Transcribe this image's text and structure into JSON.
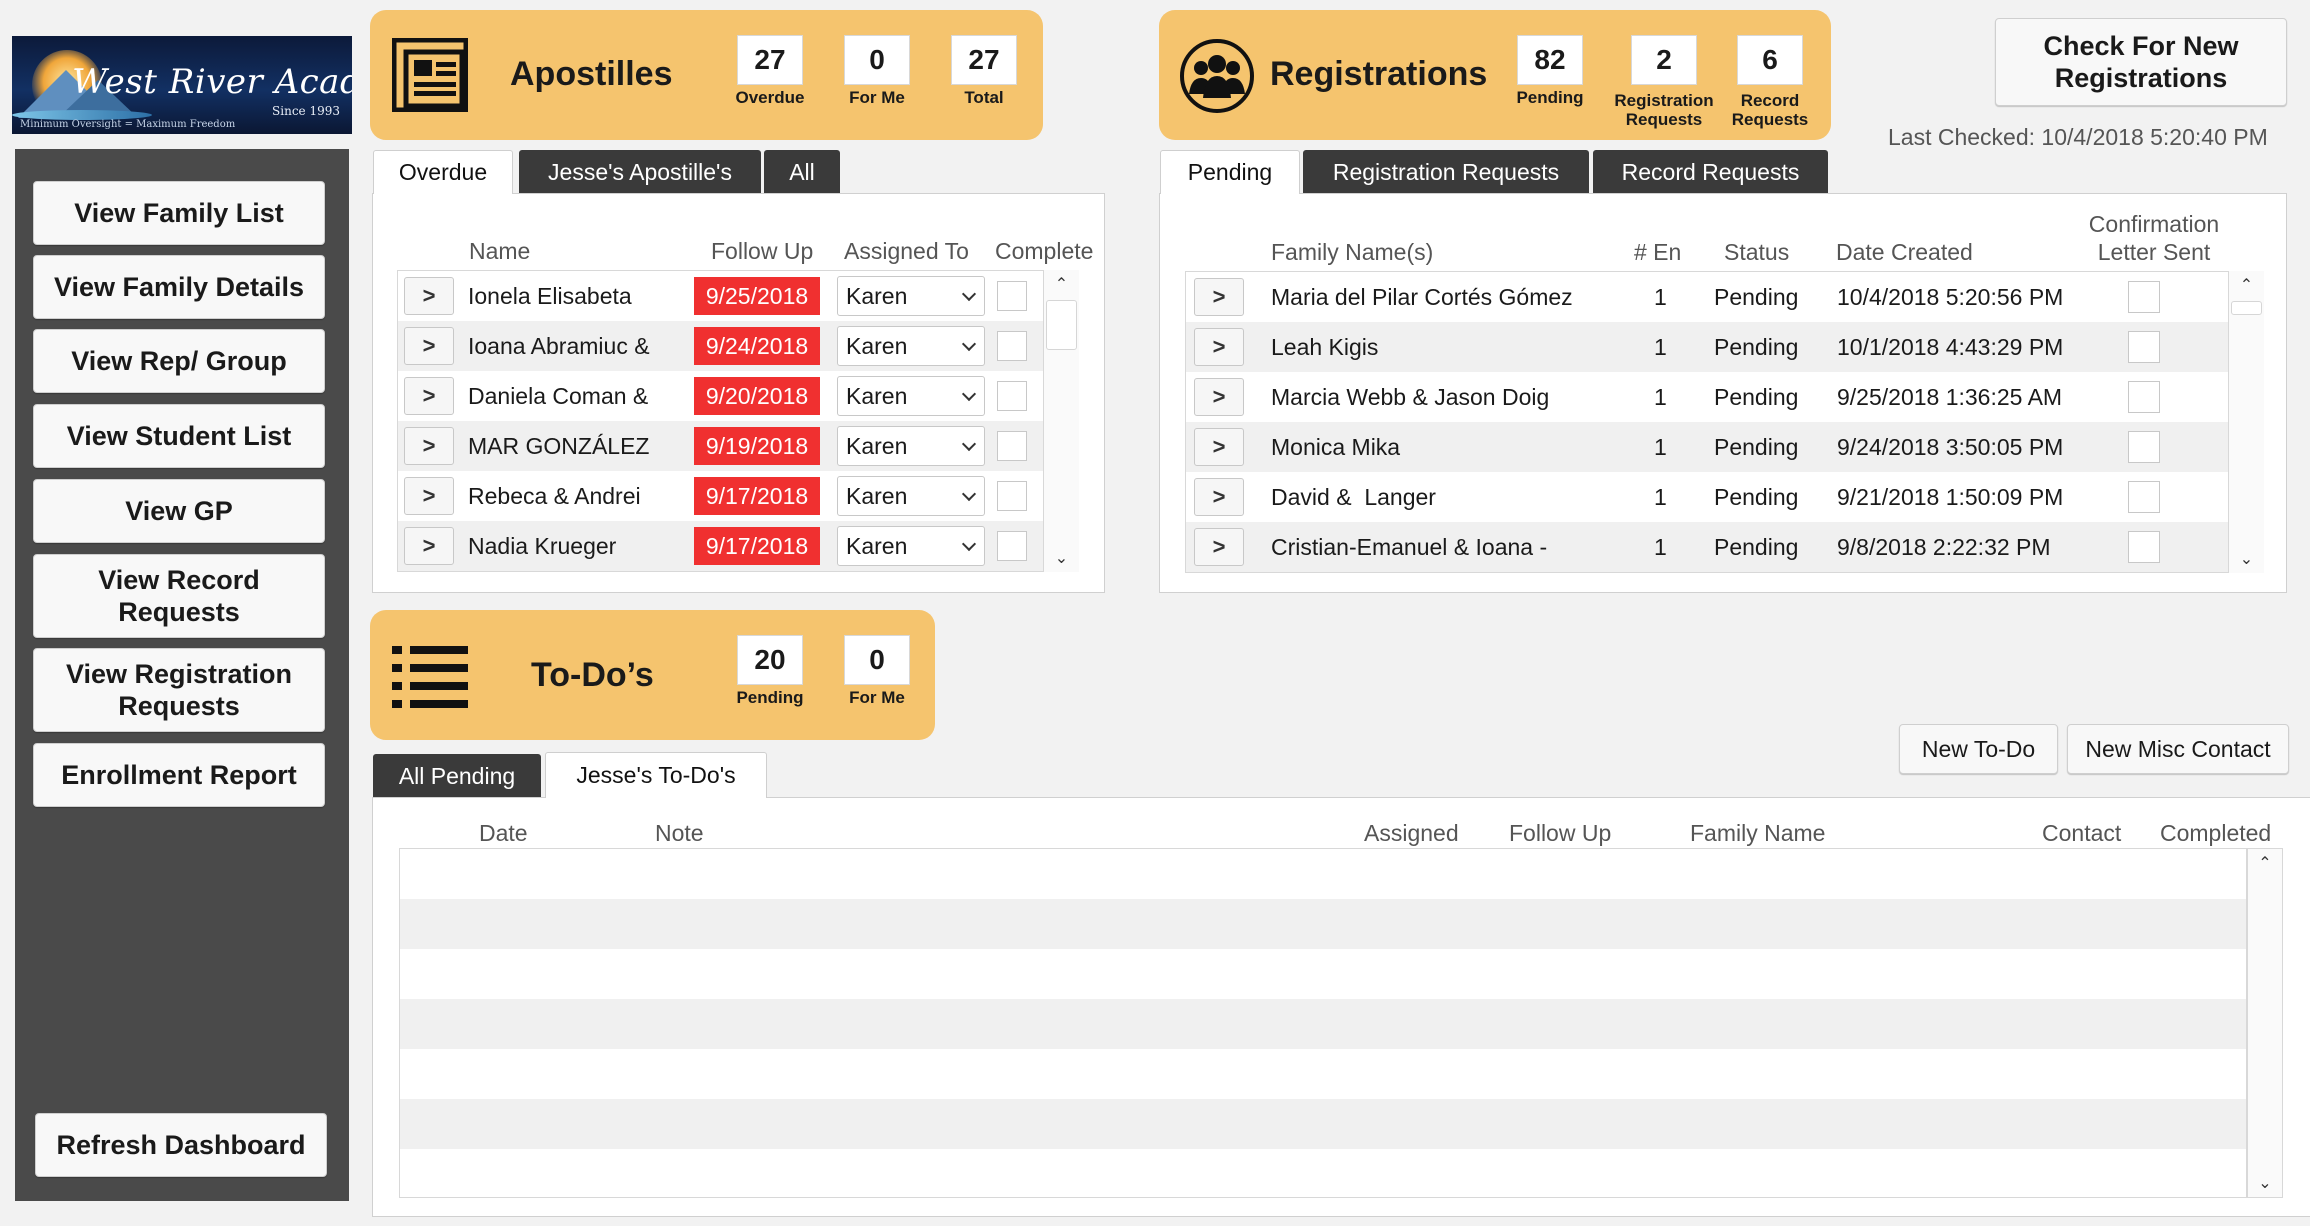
{
  "logo": {
    "name": "West River Academy",
    "since": "Since 1993",
    "motto": "Minimum Oversight = Maximum Freedom"
  },
  "sidebar": {
    "items": [
      {
        "label": "View Family List"
      },
      {
        "label": "View Family Details"
      },
      {
        "label": "View Rep/ Group"
      },
      {
        "label": "View Student List"
      },
      {
        "label": "View GP"
      },
      {
        "label": "View Record Requests"
      },
      {
        "label": "View Registration Requests"
      },
      {
        "label": "Enrollment Report"
      }
    ],
    "refresh_label": "Refresh Dashboard"
  },
  "apostilles": {
    "title": "Apostilles",
    "icon": "document-icon",
    "stats": [
      {
        "value": "27",
        "label": "Overdue"
      },
      {
        "value": "0",
        "label": "For Me"
      },
      {
        "value": "27",
        "label": "Total"
      }
    ],
    "tabs": [
      {
        "label": "Overdue",
        "active": true
      },
      {
        "label": "Jesse's Apostille's",
        "active": false
      },
      {
        "label": "All",
        "active": false
      }
    ],
    "columns": {
      "name": "Name",
      "follow_up": "Follow Up",
      "assigned": "Assigned To",
      "complete": "Complete"
    },
    "rows": [
      {
        "arrow": ">",
        "name": "Ionela Elisabeta",
        "follow_up": "9/25/2018",
        "assigned": "Karen"
      },
      {
        "arrow": ">",
        "name": "Ioana Abramiuc &",
        "follow_up": "9/24/2018",
        "assigned": "Karen"
      },
      {
        "arrow": ">",
        "name": "Daniela Coman &",
        "follow_up": "9/20/2018",
        "assigned": "Karen"
      },
      {
        "arrow": ">",
        "name": "MAR GONZÁLEZ",
        "follow_up": "9/19/2018",
        "assigned": "Karen"
      },
      {
        "arrow": ">",
        "name": "Rebeca & Andrei",
        "follow_up": "9/17/2018",
        "assigned": "Karen"
      },
      {
        "arrow": ">",
        "name": "Nadia Krueger",
        "follow_up": "9/17/2018",
        "assigned": "Karen"
      }
    ]
  },
  "registrations": {
    "title": "Registrations",
    "icon": "people-icon",
    "stats": [
      {
        "value": "82",
        "label": "Pending"
      },
      {
        "value": "2",
        "label": "Registration\nRequests",
        "l1": "Registration",
        "l2": "Requests"
      },
      {
        "value": "6",
        "label": "Record\nRequests",
        "l1": "Record",
        "l2": "Requests"
      }
    ],
    "tabs": [
      {
        "label": "Pending",
        "active": true
      },
      {
        "label": "Registration Requests",
        "active": false
      },
      {
        "label": "Record Requests",
        "active": false
      }
    ],
    "columns": {
      "family": "Family Name(s)",
      "enrolled": "# En",
      "status": "Status",
      "date_created": "Date Created",
      "conf1": "Confirmation",
      "conf2": "Letter Sent"
    },
    "rows": [
      {
        "arrow": ">",
        "family": "Maria del Pilar Cortés Gómez",
        "enrolled": "1",
        "status": "Pending",
        "date_created": "10/4/2018 5:20:56 PM"
      },
      {
        "arrow": ">",
        "family": "Leah Kigis",
        "enrolled": "1",
        "status": "Pending",
        "date_created": "10/1/2018 4:43:29 PM"
      },
      {
        "arrow": ">",
        "family": "Marcia Webb & Jason Doig",
        "enrolled": "1",
        "status": "Pending",
        "date_created": "9/25/2018 1:36:25 AM"
      },
      {
        "arrow": ">",
        "family": "Monica Mika",
        "enrolled": "1",
        "status": "Pending",
        "date_created": "9/24/2018 3:50:05 PM"
      },
      {
        "arrow": ">",
        "family": "David &  Langer",
        "enrolled": "1",
        "status": "Pending",
        "date_created": "9/21/2018 1:50:09 PM"
      },
      {
        "arrow": ">",
        "family": "Cristian-Emanuel & Ioana -",
        "enrolled": "1",
        "status": "Pending",
        "date_created": "9/8/2018 2:22:32 PM"
      }
    ]
  },
  "check_new": {
    "label1": "Check For New",
    "label2": "Registrations",
    "last_checked": "Last Checked: 10/4/2018 5:20:40 PM"
  },
  "todos": {
    "title": "To-Do’s",
    "icon": "list-icon",
    "stats": [
      {
        "value": "20",
        "label": "Pending"
      },
      {
        "value": "0",
        "label": "For Me"
      }
    ],
    "tabs": [
      {
        "label": "All Pending",
        "active": false
      },
      {
        "label": "Jesse's To-Do's",
        "active": true
      }
    ],
    "buttons": {
      "new_todo": "New To-Do",
      "new_misc": "New Misc Contact"
    },
    "columns": {
      "date": "Date",
      "note": "Note",
      "assigned": "Assigned",
      "follow_up": "Follow Up",
      "family": "Family Name",
      "contact": "Contact",
      "completed": "Completed"
    }
  }
}
